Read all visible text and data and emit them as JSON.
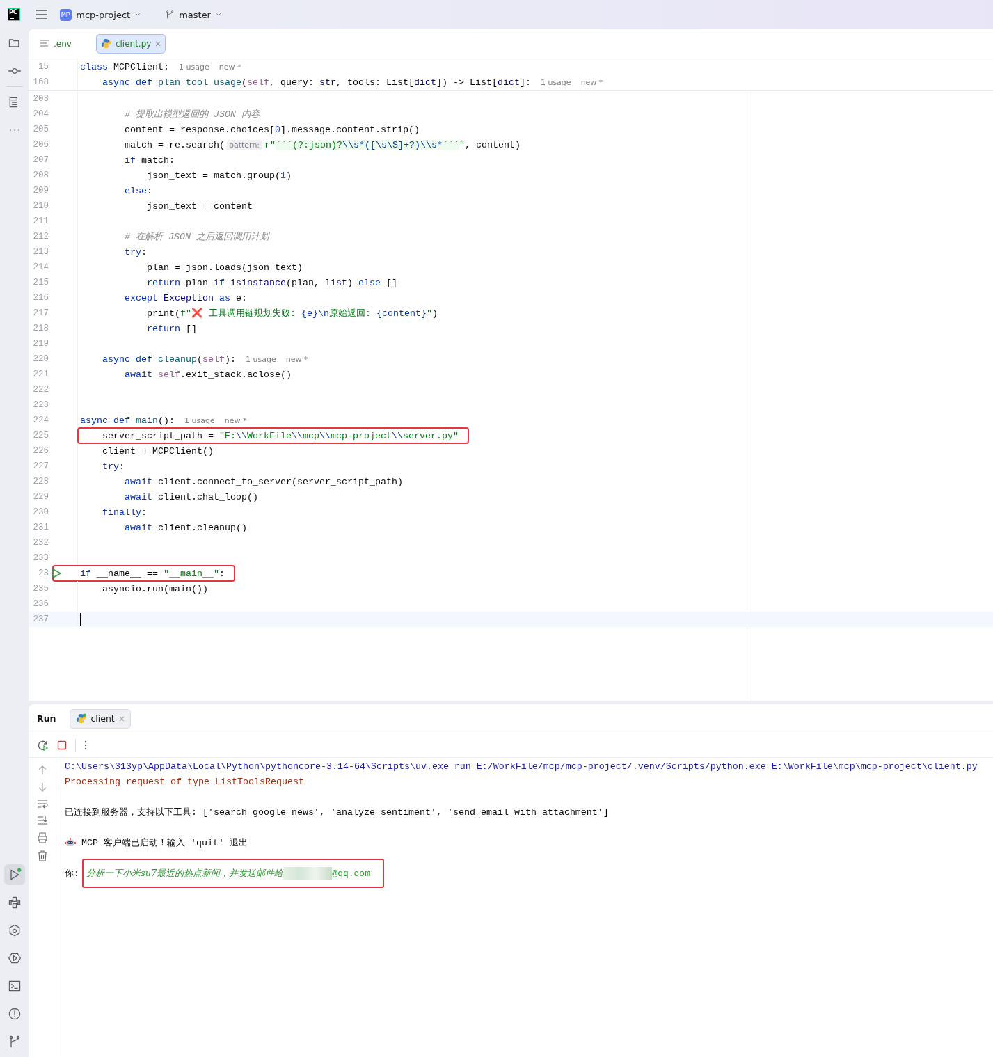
{
  "title_bar": {
    "logo_text": "PC",
    "project_badge": "MP",
    "project": "mcp-project",
    "branch": "master"
  },
  "tool_windows_top": [
    {
      "kind": "folder",
      "selected": false
    },
    {
      "kind": "commit",
      "selected": false
    },
    {
      "kind": "structure",
      "selected": false
    },
    {
      "kind": "more",
      "selected": false
    }
  ],
  "tool_windows_bottom": [
    {
      "kind": "run",
      "selected": true
    },
    {
      "kind": "python",
      "selected": false
    },
    {
      "kind": "packages",
      "selected": false
    },
    {
      "kind": "services",
      "selected": false
    },
    {
      "kind": "terminal",
      "selected": false
    },
    {
      "kind": "problems",
      "selected": false
    },
    {
      "kind": "git",
      "selected": false
    }
  ],
  "editor_tabs": [
    {
      "label": ".env",
      "kind": "text",
      "selected": false
    },
    {
      "label": "client.py",
      "kind": "python",
      "selected": true
    }
  ],
  "sticky_lines": [
    {
      "number": "15",
      "tokens": [
        {
          "t": "class",
          "kind": "kw"
        },
        {
          "t": " MCPClient:",
          "kind": "plain"
        },
        {
          "t": "1 usage",
          "kind": "hint"
        },
        {
          "t": "new *",
          "kind": "hint"
        }
      ]
    },
    {
      "number": "168",
      "tokens": [
        {
          "t": "    async def",
          "kind": "kw"
        },
        {
          "t": " plan_tool_usage",
          "kind": "fn"
        },
        {
          "t": "(",
          "kind": "plain"
        },
        {
          "t": "self",
          "kind": "self"
        },
        {
          "t": ", query: ",
          "kind": "plain"
        },
        {
          "t": "str",
          "kind": "builtin"
        },
        {
          "t": ", tools: List[",
          "kind": "plain"
        },
        {
          "t": "dict",
          "kind": "builtin"
        },
        {
          "t": "]) -> List[",
          "kind": "plain"
        },
        {
          "t": "dict",
          "kind": "builtin"
        },
        {
          "t": "]:",
          "kind": "plain"
        },
        {
          "t": "1 usage",
          "kind": "hint"
        },
        {
          "t": "new *",
          "kind": "hint"
        }
      ]
    }
  ],
  "code_lines": [
    {
      "number": "203",
      "highlighted": false,
      "current": false,
      "run_marker": false
    },
    {
      "number": "204",
      "highlighted": false,
      "current": false,
      "run_marker": false,
      "tokens": [
        {
          "t": "        # 提取出模型返回的 JSON 内容",
          "kind": "cmt"
        }
      ]
    },
    {
      "number": "205",
      "highlighted": false,
      "current": false,
      "run_marker": false,
      "tokens": [
        {
          "t": "        content = response.choices[",
          "kind": "plain"
        },
        {
          "t": "0",
          "kind": "num"
        },
        {
          "t": "].message.content.strip()",
          "kind": "plain"
        }
      ]
    },
    {
      "number": "206",
      "highlighted": false,
      "current": false,
      "run_marker": false,
      "tokens": [
        {
          "t": "        match = re.search(",
          "kind": "plain"
        },
        {
          "t": "pattern:",
          "kind": "param"
        },
        {
          "t": "r\"",
          "kind": "str"
        },
        {
          "t": "```(?:json)?",
          "kind": "rx"
        },
        {
          "t": "\\\\s*([\\s\\S]+?)\\\\s*",
          "kind": "rxesc"
        },
        {
          "t": "```",
          "kind": "rx"
        },
        {
          "t": "\"",
          "kind": "str"
        },
        {
          "t": ", content)",
          "kind": "plain"
        }
      ]
    },
    {
      "number": "207",
      "highlighted": false,
      "current": false,
      "run_marker": false,
      "tokens": [
        {
          "t": "        if",
          "kind": "kw"
        },
        {
          "t": " match:",
          "kind": "plain"
        }
      ]
    },
    {
      "number": "208",
      "highlighted": false,
      "current": false,
      "run_marker": false,
      "tokens": [
        {
          "t": "            json_text = match.group(",
          "kind": "plain"
        },
        {
          "t": "1",
          "kind": "num"
        },
        {
          "t": ")",
          "kind": "plain"
        }
      ]
    },
    {
      "number": "209",
      "highlighted": false,
      "current": false,
      "run_marker": false,
      "tokens": [
        {
          "t": "        else",
          "kind": "kw"
        },
        {
          "t": ":",
          "kind": "plain"
        }
      ]
    },
    {
      "number": "210",
      "highlighted": false,
      "current": false,
      "run_marker": false,
      "tokens": [
        {
          "t": "            json_text = content",
          "kind": "plain"
        }
      ]
    },
    {
      "number": "211",
      "highlighted": false,
      "current": false,
      "run_marker": false
    },
    {
      "number": "212",
      "highlighted": false,
      "current": false,
      "run_marker": false,
      "tokens": [
        {
          "t": "        # 在解析 JSON 之后返回调用计划",
          "kind": "cmt"
        }
      ]
    },
    {
      "number": "213",
      "highlighted": false,
      "current": false,
      "run_marker": false,
      "tokens": [
        {
          "t": "        try",
          "kind": "kw"
        },
        {
          "t": ":",
          "kind": "plain"
        }
      ]
    },
    {
      "number": "214",
      "highlighted": false,
      "current": false,
      "run_marker": false,
      "tokens": [
        {
          "t": "            plan = json.loads(json_text)",
          "kind": "plain"
        }
      ]
    },
    {
      "number": "215",
      "highlighted": false,
      "current": false,
      "run_marker": false,
      "tokens": [
        {
          "t": "            return",
          "kind": "kw"
        },
        {
          "t": " plan ",
          "kind": "plain"
        },
        {
          "t": "if",
          "kind": "kw"
        },
        {
          "t": " isinstance",
          "kind": "builtin"
        },
        {
          "t": "(plan, ",
          "kind": "plain"
        },
        {
          "t": "list",
          "kind": "builtin"
        },
        {
          "t": ") ",
          "kind": "plain"
        },
        {
          "t": "else",
          "kind": "kw"
        },
        {
          "t": " []",
          "kind": "plain"
        }
      ]
    },
    {
      "number": "216",
      "highlighted": false,
      "current": false,
      "run_marker": false,
      "tokens": [
        {
          "t": "        except",
          "kind": "kw"
        },
        {
          "t": " Exception",
          "kind": "builtin"
        },
        {
          "t": " as",
          "kind": "kw"
        },
        {
          "t": " e:",
          "kind": "plain"
        }
      ]
    },
    {
      "number": "217",
      "highlighted": false,
      "current": false,
      "run_marker": false,
      "tokens": [
        {
          "t": "            print(",
          "kind": "plain"
        },
        {
          "t": "f\"",
          "kind": "str"
        },
        {
          "t": "❌",
          "kind": "mark"
        },
        {
          "t": " 工具调用链规划失败: ",
          "kind": "str"
        },
        {
          "t": "{e}\\n",
          "kind": "esc"
        },
        {
          "t": "原始返回: ",
          "kind": "str"
        },
        {
          "t": "{content}",
          "kind": "esc"
        },
        {
          "t": "\"",
          "kind": "str"
        },
        {
          "t": ")",
          "kind": "plain"
        }
      ]
    },
    {
      "number": "218",
      "highlighted": false,
      "current": false,
      "run_marker": false,
      "tokens": [
        {
          "t": "            return",
          "kind": "kw"
        },
        {
          "t": " []",
          "kind": "plain"
        }
      ]
    },
    {
      "number": "219",
      "highlighted": false,
      "current": false,
      "run_marker": false
    },
    {
      "number": "220",
      "highlighted": false,
      "current": false,
      "run_marker": false,
      "tokens": [
        {
          "t": "    async def",
          "kind": "kw"
        },
        {
          "t": " cleanup",
          "kind": "fn"
        },
        {
          "t": "(",
          "kind": "plain"
        },
        {
          "t": "self",
          "kind": "self"
        },
        {
          "t": "):",
          "kind": "plain"
        },
        {
          "t": "1 usage",
          "kind": "hint"
        },
        {
          "t": "new *",
          "kind": "hint"
        }
      ]
    },
    {
      "number": "221",
      "highlighted": false,
      "current": false,
      "run_marker": false,
      "tokens": [
        {
          "t": "        await",
          "kind": "kw"
        },
        {
          "t": " self",
          "kind": "self"
        },
        {
          "t": ".exit_stack.aclose()",
          "kind": "plain"
        }
      ]
    },
    {
      "number": "222",
      "highlighted": false,
      "current": false,
      "run_marker": false
    },
    {
      "number": "223",
      "highlighted": false,
      "current": false,
      "run_marker": false
    },
    {
      "number": "224",
      "highlighted": false,
      "current": false,
      "run_marker": false,
      "tokens": [
        {
          "t": "async def",
          "kind": "kw"
        },
        {
          "t": " main",
          "kind": "fn"
        },
        {
          "t": "():",
          "kind": "plain"
        },
        {
          "t": "1 usage",
          "kind": "hint"
        },
        {
          "t": "new *",
          "kind": "hint"
        }
      ]
    },
    {
      "number": "225",
      "highlighted": true,
      "current": false,
      "run_marker": false,
      "tokens": [
        {
          "t": "    server_script_path = ",
          "kind": "plain"
        },
        {
          "t": "\"E:",
          "kind": "str"
        },
        {
          "t": "\\\\",
          "kind": "esc"
        },
        {
          "t": "WorkFile",
          "kind": "str"
        },
        {
          "t": "\\\\",
          "kind": "esc"
        },
        {
          "t": "mcp",
          "kind": "str"
        },
        {
          "t": "\\\\",
          "kind": "esc"
        },
        {
          "t": "mcp-project",
          "kind": "str"
        },
        {
          "t": "\\\\",
          "kind": "esc"
        },
        {
          "t": "server.py\"",
          "kind": "str"
        }
      ]
    },
    {
      "number": "226",
      "highlighted": false,
      "current": false,
      "run_marker": false,
      "tokens": [
        {
          "t": "    client = MCPClient()",
          "kind": "plain"
        }
      ]
    },
    {
      "number": "227",
      "highlighted": false,
      "current": false,
      "run_marker": false,
      "tokens": [
        {
          "t": "    try",
          "kind": "kw"
        },
        {
          "t": ":",
          "kind": "plain"
        }
      ]
    },
    {
      "number": "228",
      "highlighted": false,
      "current": false,
      "run_marker": false,
      "tokens": [
        {
          "t": "        await",
          "kind": "kw"
        },
        {
          "t": " client.connect_to_server(server_script_path)",
          "kind": "plain"
        }
      ]
    },
    {
      "number": "229",
      "highlighted": false,
      "current": false,
      "run_marker": false,
      "tokens": [
        {
          "t": "        await",
          "kind": "kw"
        },
        {
          "t": " client.chat_loop()",
          "kind": "plain"
        }
      ]
    },
    {
      "number": "230",
      "highlighted": false,
      "current": false,
      "run_marker": false,
      "tokens": [
        {
          "t": "    finally",
          "kind": "kw"
        },
        {
          "t": ":",
          "kind": "plain"
        }
      ]
    },
    {
      "number": "231",
      "highlighted": false,
      "current": false,
      "run_marker": false,
      "tokens": [
        {
          "t": "        await",
          "kind": "kw"
        },
        {
          "t": " client.cleanup()",
          "kind": "plain"
        }
      ]
    },
    {
      "number": "232",
      "highlighted": false,
      "current": false,
      "run_marker": false
    },
    {
      "number": "233",
      "highlighted": false,
      "current": false,
      "run_marker": false
    },
    {
      "number": "23",
      "highlighted": true,
      "current": false,
      "run_marker": true,
      "tokens": [
        {
          "t": "if",
          "kind": "kw"
        },
        {
          "t": " __name__ == ",
          "kind": "plain"
        },
        {
          "t": "\"__main__\"",
          "kind": "str"
        },
        {
          "t": ":",
          "kind": "plain"
        }
      ]
    },
    {
      "number": "235",
      "highlighted": false,
      "current": false,
      "run_marker": false,
      "tokens": [
        {
          "t": "    asyncio.run(main())",
          "kind": "plain"
        }
      ]
    },
    {
      "number": "236",
      "highlighted": false,
      "current": false,
      "run_marker": false
    },
    {
      "number": "237",
      "highlighted": false,
      "current": true,
      "run_marker": false
    }
  ],
  "run_panel": {
    "title": "Run",
    "tabs": [
      {
        "label": "client",
        "selected": true
      }
    ],
    "console": [
      {
        "kind": "command",
        "text": "C:\\Users\\313yp\\AppData\\Local\\Python\\pythoncore-3.14-64\\Scripts\\uv.exe run E:/WorkFile/mcp/mcp-project/.venv/Scripts/python.exe E:\\WorkFile\\mcp\\mcp-project\\client.py"
      },
      {
        "kind": "stderr",
        "text": "Processing request of type ListToolsRequest"
      },
      {
        "kind": "blank"
      },
      {
        "kind": "plain",
        "text": "已连接到服务器，支持以下工具: ['search_google_news', 'analyze_sentiment', 'send_email_with_attachment']"
      },
      {
        "kind": "blank"
      },
      {
        "kind": "robot",
        "text": "MCP 客户端已启动！输入 'quit' 退出"
      },
      {
        "kind": "blank"
      },
      {
        "kind": "input",
        "prompt": "你:",
        "text": "分析一下小米su7最近的热点新闻，并发送邮件给",
        "suffix": "@qq.com",
        "redacted": true,
        "highlighted": true
      }
    ]
  }
}
